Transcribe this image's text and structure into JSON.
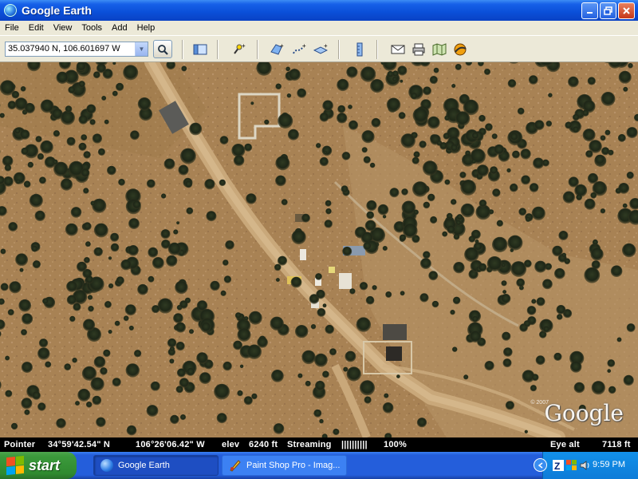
{
  "window": {
    "title": "Google Earth",
    "controls": [
      "minimize",
      "maximize",
      "close"
    ]
  },
  "menu": [
    "File",
    "Edit",
    "View",
    "Tools",
    "Add",
    "Help"
  ],
  "toolbar": {
    "search_value": "35.037940 N, 106.601697 W",
    "icons": [
      "sidebar-toggle-icon",
      "add-placemark-icon",
      "add-polygon-icon",
      "add-path-icon",
      "add-image-overlay-icon",
      "ruler-icon",
      "email-icon",
      "print-icon",
      "view-in-maps-icon",
      "sky-icon"
    ]
  },
  "map": {
    "logo": "Google",
    "copyright": "© 2007"
  },
  "status": {
    "pointer_label": "Pointer",
    "latitude": "34°59'42.54\" N",
    "longitude": "106°26'06.42\" W",
    "elev_label": "elev",
    "elev_value": "6240 ft",
    "streaming_label": "Streaming",
    "streaming_bars": "||||||||||",
    "streaming_percent": "100%",
    "eye_alt_label": "Eye alt",
    "eye_alt_value": "7118 ft"
  },
  "taskbar": {
    "start_label": "start",
    "tasks": [
      {
        "label": "Google Earth",
        "active": true
      },
      {
        "label": "Paint Shop Pro - Imag...",
        "active": false
      }
    ],
    "clock": "9:59 PM"
  },
  "colors": {
    "title_blue": "#0a4fd8",
    "taskbar_blue": "#245edb",
    "start_green": "#3c9a3c",
    "terrain": "#a88254"
  }
}
